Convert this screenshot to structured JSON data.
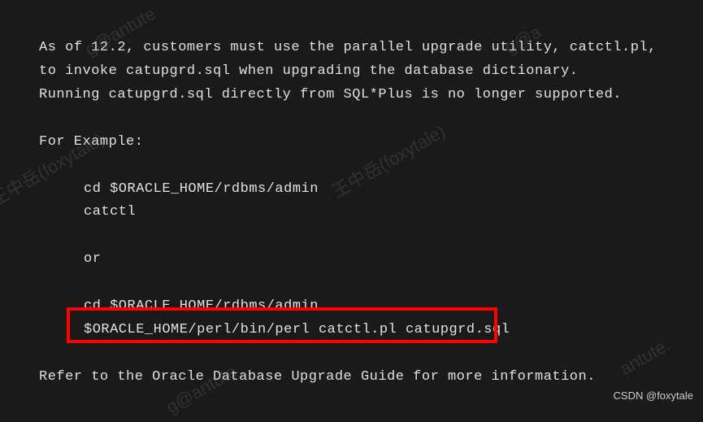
{
  "lines": {
    "l1": "As of 12.2, customers must use the parallel upgrade utility, catctl.pl,",
    "l2": "to invoke catupgrd.sql when upgrading the database dictionary.",
    "l3": "Running catupgrd.sql directly from SQL*Plus is no longer supported.",
    "l4": "For Example:",
    "l5": "cd $ORACLE_HOME/rdbms/admin",
    "l6": "catctl",
    "l7": "or",
    "l8": "cd $ORACLE_HOME/rdbms/admin",
    "l9": "$ORACLE_HOME/perl/bin/perl catctl.pl catupgrd.sql",
    "l10": "Refer to the Oracle Database Upgrade Guide for more information."
  },
  "watermarks": {
    "wm1": "g@antute",
    "wm2": "g@a",
    "wm3": "王中岳(foxytale)",
    "wm4": "王中岳(foxytale)",
    "wm5": "antute.",
    "wm6": "g@antute"
  },
  "credit": "CSDN @foxytale"
}
